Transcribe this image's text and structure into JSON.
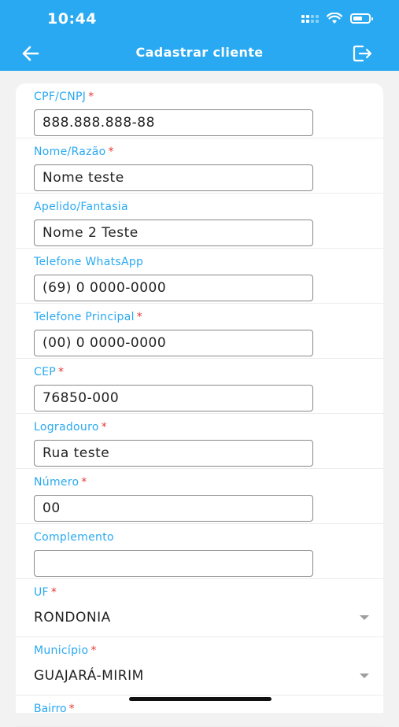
{
  "status": {
    "time": "10:44"
  },
  "header": {
    "title": "Cadastrar cliente"
  },
  "fields": [
    {
      "label": "CPF/CNPJ",
      "required": "*",
      "value": "888.888.888-88"
    },
    {
      "label": "Nome/Razão",
      "required": "*",
      "value": "Nome teste"
    },
    {
      "label": "Apelido/Fantasia",
      "required": "",
      "value": "Nome 2 Teste"
    },
    {
      "label": "Telefone WhatsApp",
      "required": "",
      "value": "(69) 0 0000-0000"
    },
    {
      "label": "Telefone Principal",
      "required": "*",
      "value": "(00) 0 0000-0000"
    },
    {
      "label": "CEP",
      "required": "*",
      "value": "76850-000"
    },
    {
      "label": "Logradouro",
      "required": "*",
      "value": "Rua teste"
    },
    {
      "label": "Número",
      "required": "*",
      "value": "00"
    },
    {
      "label": "Complemento",
      "required": "",
      "value": ""
    }
  ],
  "selects": [
    {
      "label": "UF",
      "required": "*",
      "value": "RONDONIA"
    },
    {
      "label": "Município",
      "required": "*",
      "value": "GUAJARÁ-MIRIM"
    }
  ],
  "partial": {
    "label": "Bairro",
    "required": "*"
  },
  "colors": {
    "accent": "#29a9f1",
    "required": "#e53935"
  }
}
